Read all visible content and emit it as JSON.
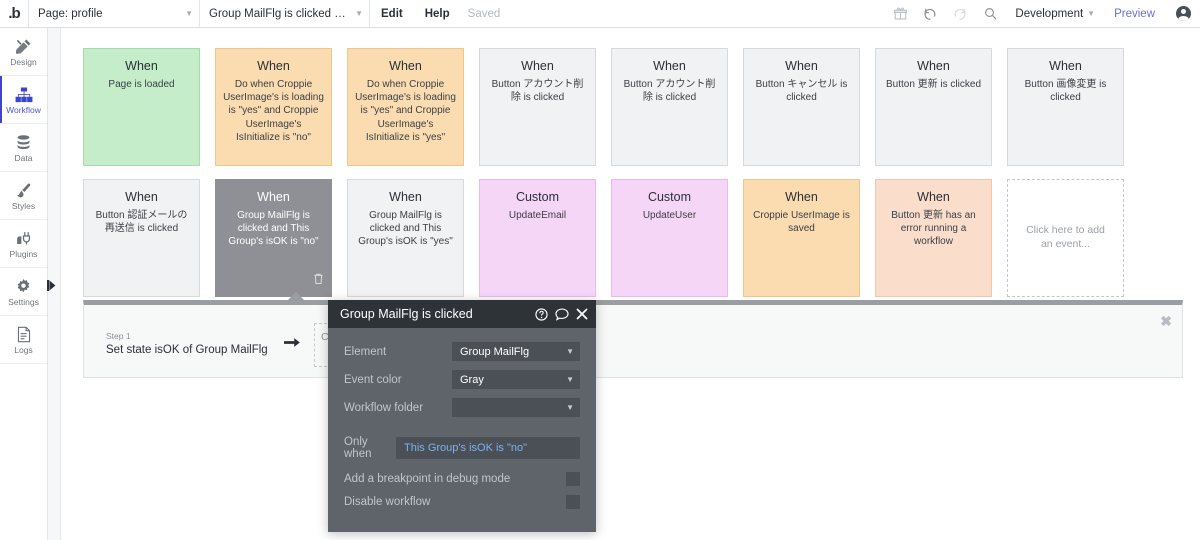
{
  "topbar": {
    "logo": "b-logo-icon",
    "page_label": "Page: profile",
    "workflow_label": "Group MailFlg is clicked and This...",
    "edit_label": "Edit",
    "help_label": "Help",
    "save_status": "Saved",
    "gift_icon": "gift-icon",
    "undo_icon": "undo-icon",
    "redo_icon": "redo-icon",
    "search_icon": "search-icon",
    "version_label": "Development",
    "preview_label": "Preview",
    "avatar": "user-avatar"
  },
  "sidebar": {
    "items": [
      {
        "label": "Design",
        "icon": "design-icon",
        "active": false
      },
      {
        "label": "Workflow",
        "icon": "workflow-icon",
        "active": true
      },
      {
        "label": "Data",
        "icon": "database-icon",
        "active": false
      },
      {
        "label": "Styles",
        "icon": "brush-icon",
        "active": false
      },
      {
        "label": "Plugins",
        "icon": "plugins-icon",
        "active": false
      },
      {
        "label": "Settings",
        "icon": "gear-icon",
        "active": false
      },
      {
        "label": "Logs",
        "icon": "logs-icon",
        "active": false
      }
    ]
  },
  "canvas": {
    "cards": [
      {
        "title": "When",
        "subtitle": "Page is loaded",
        "color": "green",
        "selected": false
      },
      {
        "title": "When",
        "subtitle": "Do when Croppie UserImage's is loading is \"yes\" and Croppie UserImage's IsInitialize is \"no\"",
        "color": "orange",
        "selected": false
      },
      {
        "title": "When",
        "subtitle": "Do when Croppie UserImage's is loading is \"yes\" and Croppie UserImage's IsInitialize is \"yes\"",
        "color": "orange",
        "selected": false
      },
      {
        "title": "When",
        "subtitle": "Button アカウント削除 is clicked",
        "color": "gray",
        "selected": false
      },
      {
        "title": "When",
        "subtitle": "Button アカウント削除 is clicked",
        "color": "gray",
        "selected": false
      },
      {
        "title": "When",
        "subtitle": "Button キャンセル is clicked",
        "color": "gray",
        "selected": false
      },
      {
        "title": "When",
        "subtitle": "Button 更新 is clicked",
        "color": "gray",
        "selected": false
      },
      {
        "title": "When",
        "subtitle": "Button 画像変更 is clicked",
        "color": "gray",
        "selected": false
      },
      {
        "title": "When",
        "subtitle": "Button 認証メールの再送信 is clicked",
        "color": "gray",
        "selected": false
      },
      {
        "title": "When",
        "subtitle": "Group MailFlg is clicked and This Group's isOK is \"no\"",
        "color": "gray-selected",
        "selected": true
      },
      {
        "title": "When",
        "subtitle": "Group MailFlg is clicked and This Group's isOK is \"yes\"",
        "color": "gray",
        "selected": false
      },
      {
        "title": "Custom",
        "subtitle": "UpdateEmail",
        "color": "pink",
        "selected": false
      },
      {
        "title": "Custom",
        "subtitle": "UpdateUser",
        "color": "pink",
        "selected": false
      },
      {
        "title": "When",
        "subtitle": "Croppie UserImage is saved",
        "color": "lightorange",
        "selected": false
      },
      {
        "title": "When",
        "subtitle": "Button 更新 has an error running a workflow",
        "color": "peach",
        "selected": false
      },
      {
        "title": "",
        "subtitle": "Click here to add an event...",
        "color": "addnew",
        "selected": false
      }
    ]
  },
  "action_panel": {
    "step_number": "Step 1",
    "step_text": "Set state isOK of Group MailFlg",
    "arrow_icon": "arrow-right-icon",
    "add_step_label": "Click here to add an action...",
    "close_icon": "close-icon"
  },
  "property_dialog": {
    "title": "Group MailFlg is clicked",
    "help_icon": "question-circle-icon",
    "comment_icon": "comment-icon",
    "close_icon": "close-icon",
    "rows": [
      {
        "label": "Element",
        "value": "Group MailFlg"
      },
      {
        "label": "Event color",
        "value": "Gray"
      },
      {
        "label": "Workflow folder",
        "value": ""
      }
    ],
    "only_when_label": "Only when",
    "only_when_value": "This Group's isOK is \"no\"",
    "breakpoint_label": "Add a breakpoint in debug mode",
    "disable_label": "Disable workflow"
  },
  "colors": {
    "accent": "#3d46c9",
    "preview_link": "#6a6fd6",
    "selected_card": "#8e9095",
    "dialog_bg": "#5e646a",
    "dialog_header": "#2e3338",
    "expression_blue": "#7bb2ef"
  }
}
